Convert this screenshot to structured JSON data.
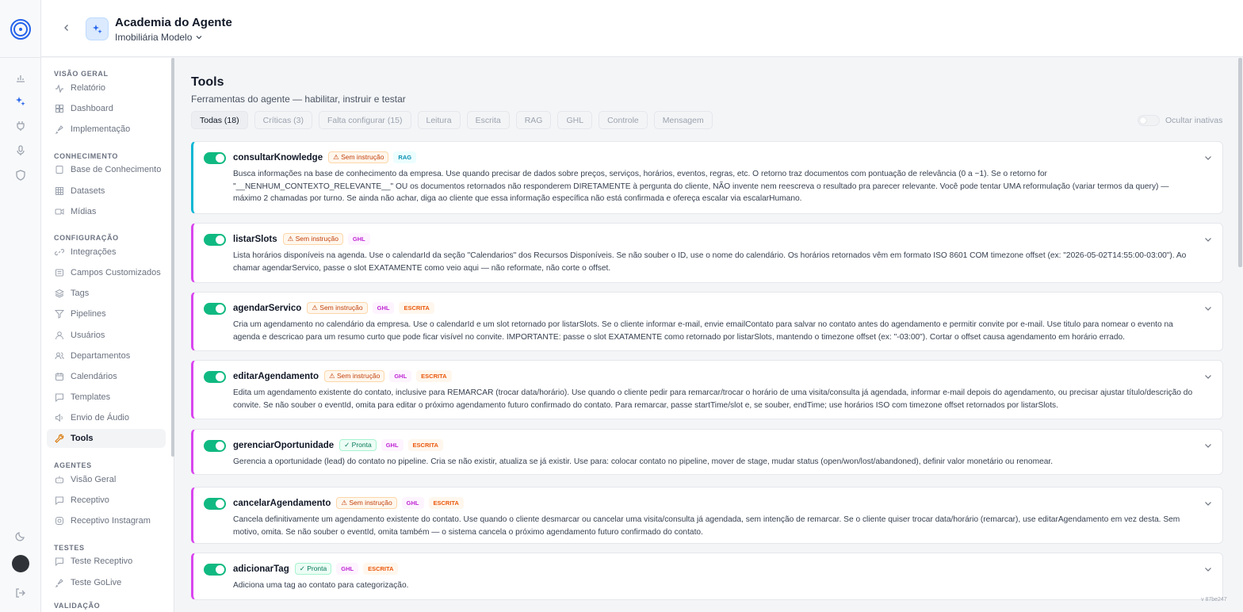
{
  "header": {
    "agent_title": "Academia do Agente",
    "workspace": "Imobiliária Modelo"
  },
  "sidebar": {
    "sections": [
      {
        "title": "VISÃO GERAL",
        "items": [
          {
            "label": "Relatório",
            "icon": "activity-icon"
          },
          {
            "label": "Dashboard",
            "icon": "grid-icon"
          },
          {
            "label": "Implementação",
            "icon": "rocket-icon"
          }
        ]
      },
      {
        "title": "CONHECIMENTO",
        "items": [
          {
            "label": "Base de Conhecimento",
            "icon": "book-icon"
          },
          {
            "label": "Datasets",
            "icon": "table-icon"
          },
          {
            "label": "Mídias",
            "icon": "video-icon"
          }
        ]
      },
      {
        "title": "CONFIGURAÇÃO",
        "items": [
          {
            "label": "Integrações",
            "icon": "link-icon"
          },
          {
            "label": "Campos Customizados",
            "icon": "list-icon"
          },
          {
            "label": "Tags",
            "icon": "layers-icon"
          },
          {
            "label": "Pipelines",
            "icon": "filter-icon"
          },
          {
            "label": "Usuários",
            "icon": "user-icon"
          },
          {
            "label": "Departamentos",
            "icon": "users-icon"
          },
          {
            "label": "Calendários",
            "icon": "calendar-icon"
          },
          {
            "label": "Templates",
            "icon": "message-icon"
          },
          {
            "label": "Envio de Áudio",
            "icon": "volume-icon"
          },
          {
            "label": "Tools",
            "icon": "wrench-icon",
            "active": true
          }
        ]
      },
      {
        "title": "AGENTES",
        "items": [
          {
            "label": "Visão Geral",
            "icon": "bot-icon"
          },
          {
            "label": "Receptivo",
            "icon": "message-icon"
          },
          {
            "label": "Receptivo Instagram",
            "icon": "instagram-icon"
          }
        ]
      },
      {
        "title": "TESTES",
        "items": [
          {
            "label": "Teste Receptivo",
            "icon": "message-icon"
          },
          {
            "label": "Teste GoLive",
            "icon": "rocket-icon"
          }
        ]
      },
      {
        "title": "VALIDAÇÃO",
        "items": []
      }
    ]
  },
  "main": {
    "title": "Tools",
    "subtitle": "Ferramentas do agente — habilitar, instruir e testar",
    "filters": [
      {
        "label": "Todas (18)",
        "active": true
      },
      {
        "label": "Críticas (3)"
      },
      {
        "label": "Falta configurar (15)"
      },
      {
        "label": "Leitura"
      },
      {
        "label": "Escrita"
      },
      {
        "label": "RAG"
      },
      {
        "label": "GHL"
      },
      {
        "label": "Controle"
      },
      {
        "label": "Mensagem"
      }
    ],
    "hide_inactive_label": "Ocultar inativas",
    "tools": [
      {
        "name": "consultarKnowledge",
        "status": "⚠ Sem instrução",
        "status_type": "warn",
        "tags": [
          "RAG"
        ],
        "description": "Busca informações na base de conhecimento da empresa. Use quando precisar de dados sobre preços, serviços, horários, eventos, regras, etc. O retorno traz documentos com pontuação de relevância (0 a ~1). Se o retorno for \"__NENHUM_CONTEXTO_RELEVANTE__\" OU os documentos retornados não responderem DIRETAMENTE à pergunta do cliente, NÃO invente nem reescreva o resultado pra parecer relevante. Você pode tentar UMA reformulação (variar termos da query) — máximo 2 chamadas por turno. Se ainda não achar, diga ao cliente que essa informação específica não está confirmada e ofereça escalar via escalarHumano."
      },
      {
        "name": "listarSlots",
        "status": "⚠ Sem instrução",
        "status_type": "warn",
        "tags": [
          "GHL"
        ],
        "description": "Lista horários disponíveis na agenda. Use o calendarId da seção \"Calendarios\" dos Recursos Disponíveis. Se não souber o ID, use o nome do calendário. Os horários retornados vêm em formato ISO 8601 COM timezone offset (ex: \"2026-05-02T14:55:00-03:00\"). Ao chamar agendarServico, passe o slot EXATAMENTE como veio aqui — não reformate, não corte o offset."
      },
      {
        "name": "agendarServico",
        "status": "⚠ Sem instrução",
        "status_type": "warn",
        "tags": [
          "GHL",
          "ESCRITA"
        ],
        "description": "Cria um agendamento no calendário da empresa. Use o calendarId e um slot retornado por listarSlots. Se o cliente informar e-mail, envie emailContato para salvar no contato antes do agendamento e permitir convite por e-mail. Use titulo para nomear o evento na agenda e descricao para um resumo curto que pode ficar visível no convite. IMPORTANTE: passe o slot EXATAMENTE como retornado por listarSlots, mantendo o timezone offset (ex: \"-03:00\"). Cortar o offset causa agendamento em horário errado."
      },
      {
        "name": "editarAgendamento",
        "status": "⚠ Sem instrução",
        "status_type": "warn",
        "tags": [
          "GHL",
          "ESCRITA"
        ],
        "description": "Edita um agendamento existente do contato, inclusive para REMARCAR (trocar data/horário). Use quando o cliente pedir para remarcar/trocar o horário de uma visita/consulta já agendada, informar e-mail depois do agendamento, ou precisar ajustar título/descrição do convite. Se não souber o eventId, omita para editar o próximo agendamento futuro confirmado do contato. Para remarcar, passe startTime/slot e, se souber, endTime; use horários ISO com timezone offset retornados por listarSlots."
      },
      {
        "name": "gerenciarOportunidade",
        "status": "✓ Pronta",
        "status_type": "ok",
        "tags": [
          "GHL",
          "ESCRITA"
        ],
        "description": "Gerencia a oportunidade (lead) do contato no pipeline. Cria se não existir, atualiza se já existir. Use para: colocar contato no pipeline, mover de stage, mudar status (open/won/lost/abandoned), definir valor monetário ou renomear."
      },
      {
        "name": "cancelarAgendamento",
        "status": "⚠ Sem instrução",
        "status_type": "warn",
        "tags": [
          "GHL",
          "ESCRITA"
        ],
        "description": "Cancela definitivamente um agendamento existente do contato. Use quando o cliente desmarcar ou cancelar uma visita/consulta já agendada, sem intenção de remarcar. Se o cliente quiser trocar data/horário (remarcar), use editarAgendamento em vez desta. Sem motivo, omita. Se não souber o eventId, omita também — o sistema cancela o próximo agendamento futuro confirmado do contato."
      },
      {
        "name": "adicionarTag",
        "status": "✓ Pronta",
        "status_type": "ok",
        "tags": [
          "GHL",
          "ESCRITA"
        ],
        "description": "Adiciona uma tag ao contato para categorização."
      }
    ]
  },
  "footer": {
    "version": "v 87be247"
  },
  "colors": {
    "accent": "#2563eb",
    "toggle_on": "#10b981",
    "ghl": "#d946ef",
    "rag": "#06b6d4"
  }
}
